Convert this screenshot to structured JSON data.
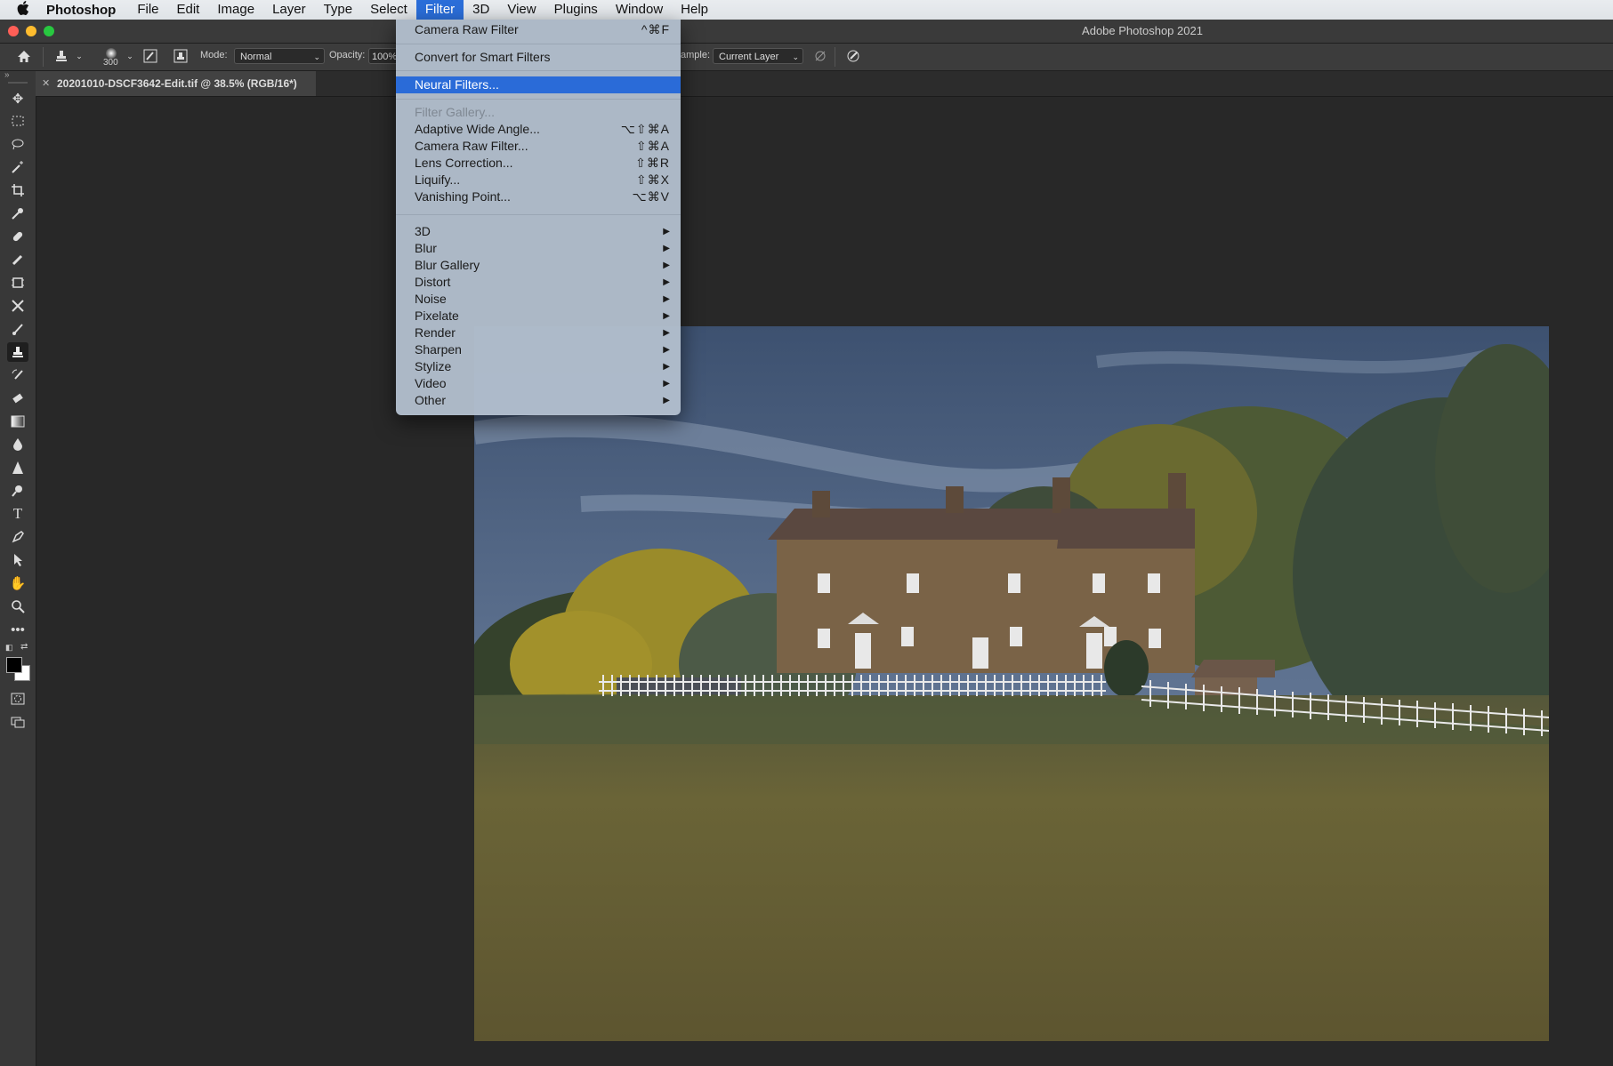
{
  "menubar": {
    "app": "Photoshop",
    "items": [
      "File",
      "Edit",
      "Image",
      "Layer",
      "Type",
      "Select",
      "Filter",
      "3D",
      "View",
      "Plugins",
      "Window",
      "Help"
    ],
    "active_index": 6
  },
  "window": {
    "title": "Adobe Photoshop 2021"
  },
  "options_bar": {
    "brush_size": "300",
    "mode_label": "Mode:",
    "mode_value": "Normal",
    "opacity_label": "Opacity:",
    "opacity_value": "100%",
    "sample_label": "ample:",
    "sample_value": "Current Layer"
  },
  "document": {
    "tab_title": "20201010-DSCF3642-Edit.tif @ 38.5% (RGB/16*)"
  },
  "filter_menu": {
    "top_items": [
      {
        "label": "Camera Raw Filter",
        "shortcut": "^⌘F"
      },
      {
        "label": "Convert for Smart Filters",
        "shortcut": ""
      },
      {
        "label": "Neural Filters...",
        "shortcut": "",
        "highlighted": true
      }
    ],
    "gallery": {
      "label": "Filter Gallery...",
      "disabled": true
    },
    "mid_items": [
      {
        "label": "Adaptive Wide Angle...",
        "shortcut": "⌥⇧⌘A"
      },
      {
        "label": "Camera Raw Filter...",
        "shortcut": "⇧⌘A"
      },
      {
        "label": "Lens Correction...",
        "shortcut": "⇧⌘R"
      },
      {
        "label": "Liquify...",
        "shortcut": "⇧⌘X"
      },
      {
        "label": "Vanishing Point...",
        "shortcut": "⌥⌘V"
      }
    ],
    "submenus": [
      "3D",
      "Blur",
      "Blur Gallery",
      "Distort",
      "Noise",
      "Pixelate",
      "Render",
      "Sharpen",
      "Stylize",
      "Video",
      "Other"
    ],
    "submenu_arrow": "▶"
  },
  "toolbar": {
    "tools": [
      "move",
      "marquee",
      "lasso",
      "magic-wand",
      "crop",
      "eyedropper",
      "healing",
      "brush-alt",
      "frame",
      "patch",
      "brush",
      "clone-stamp",
      "history-brush",
      "eraser",
      "gradient",
      "blur",
      "sharpen",
      "dodge",
      "type",
      "pen",
      "path-selection",
      "hand",
      "zoom",
      "more",
      "swap-colors",
      "color-swatches",
      "quick-mask",
      "screen-mode"
    ],
    "selected_tool": "clone-stamp"
  },
  "colors": {
    "accent": "#2b6ed9",
    "panel": "#383838",
    "canvas": "#282828"
  }
}
